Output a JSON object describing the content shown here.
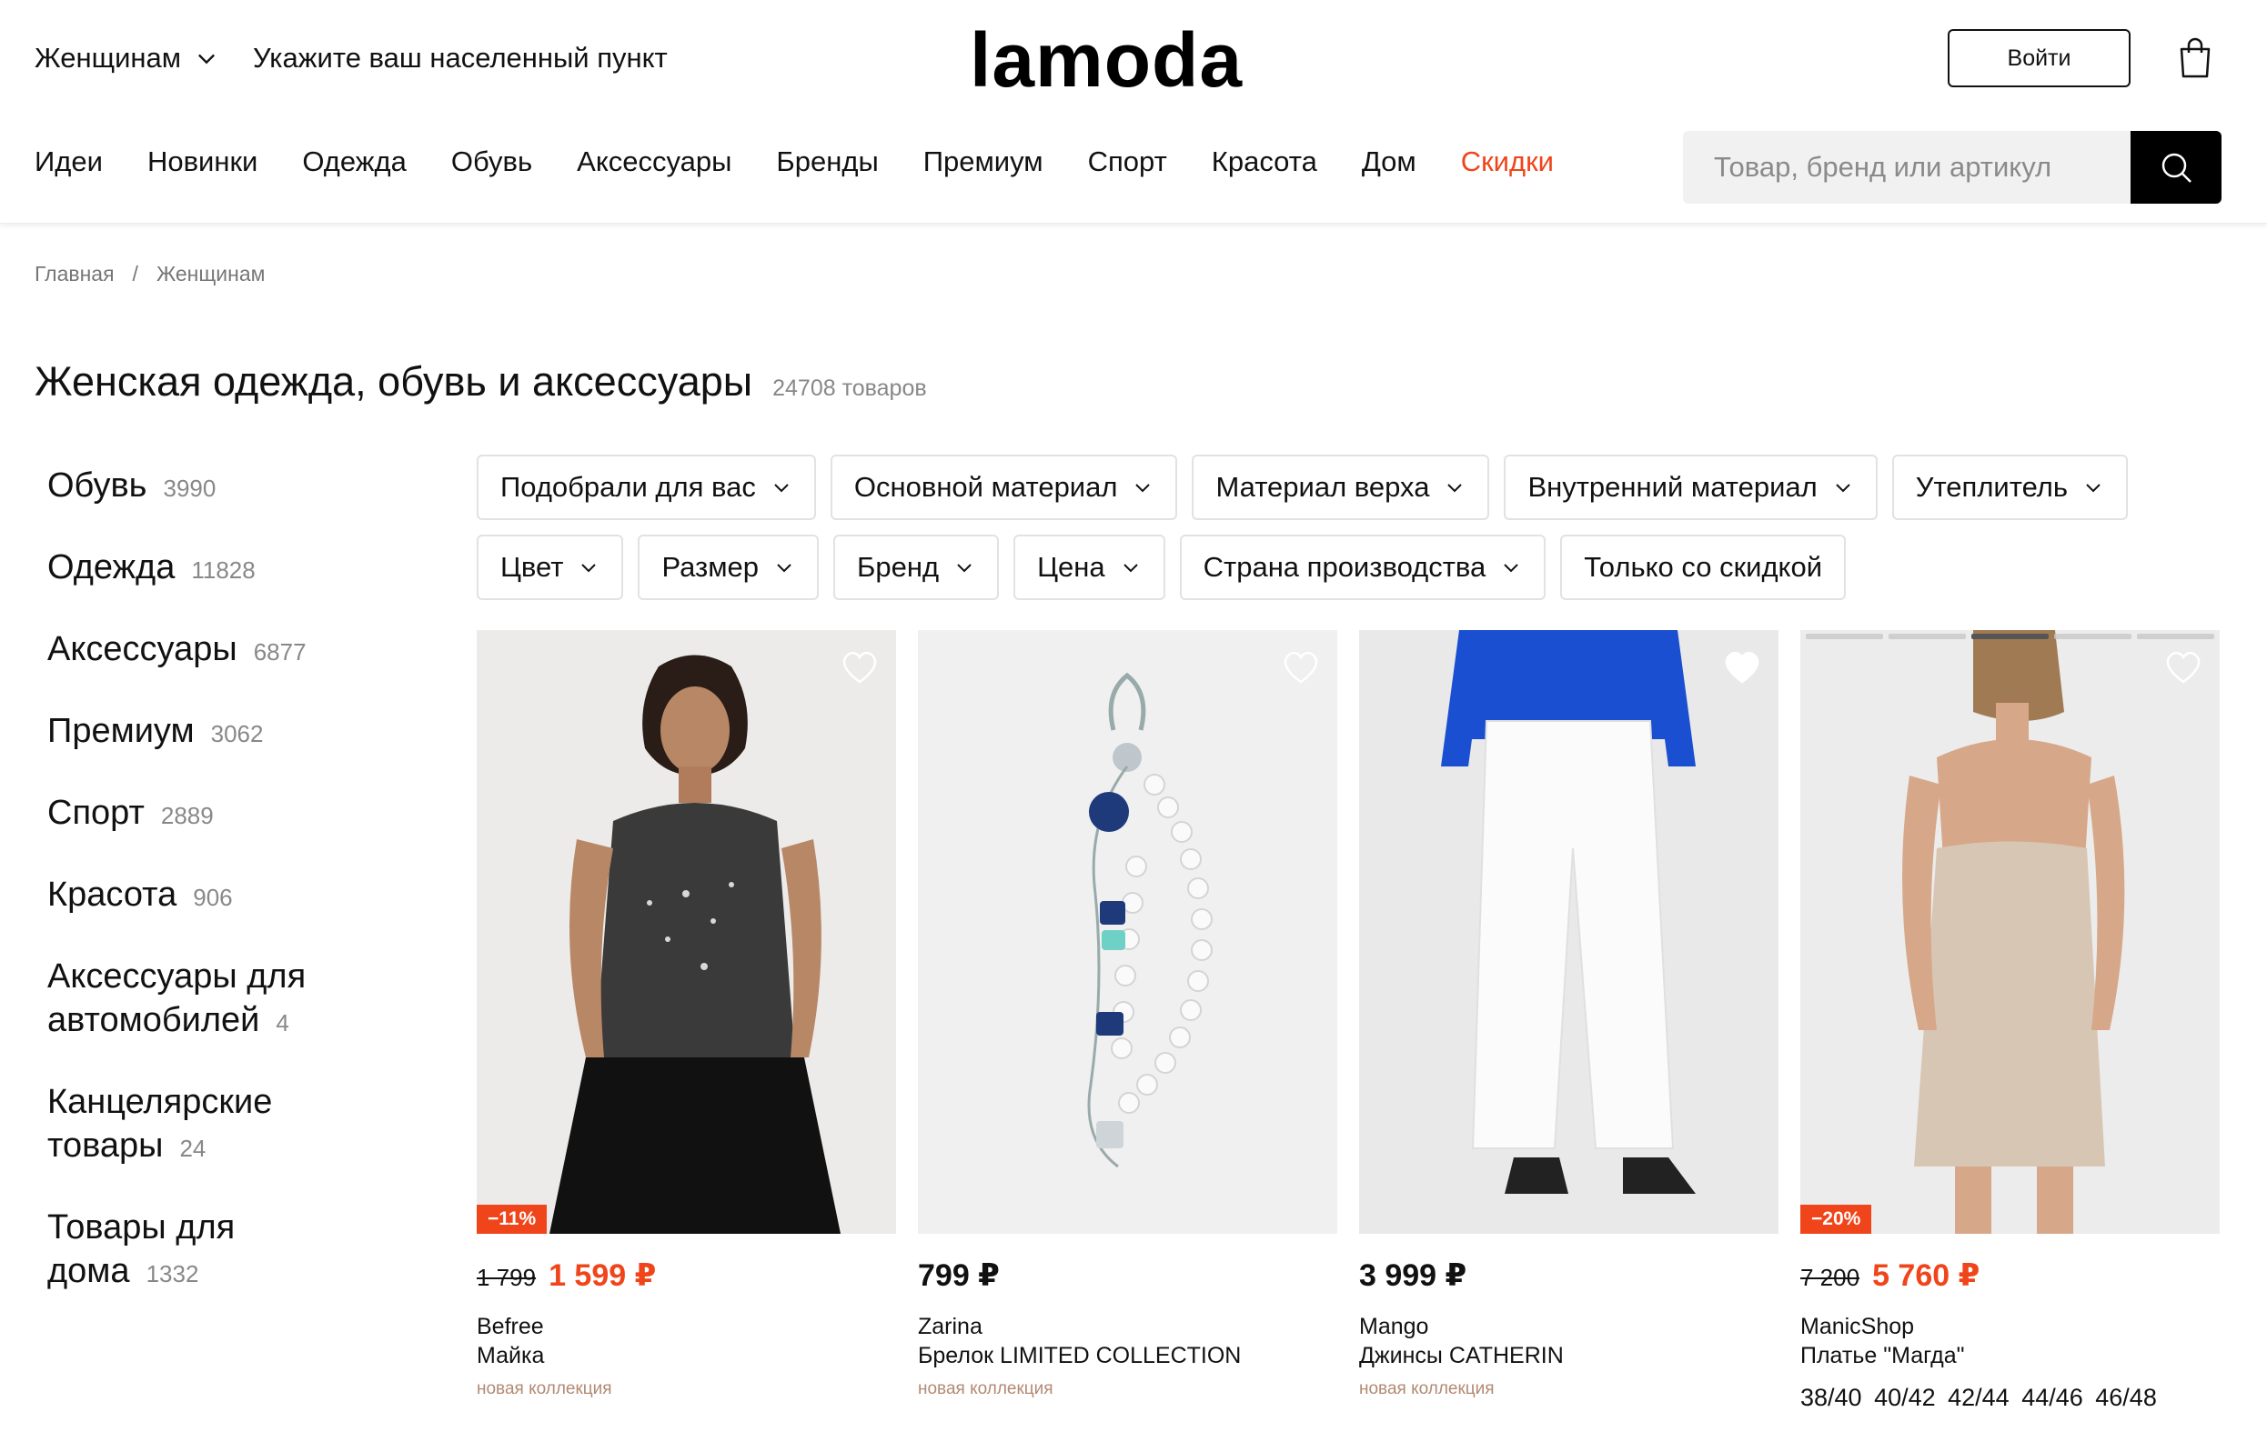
{
  "header": {
    "gender": "Женщинам",
    "location": "Укажите ваш населенный пункт",
    "logo": "lamoda",
    "login": "Войти",
    "search_placeholder": "Товар, бренд или артикул"
  },
  "nav": [
    "Идеи",
    "Новинки",
    "Одежда",
    "Обувь",
    "Аксессуары",
    "Бренды",
    "Премиум",
    "Спорт",
    "Красота",
    "Дом",
    "Скидки"
  ],
  "accent_color": "#f0451a",
  "breadcrumb": {
    "home": "Главная",
    "sep": "/",
    "current": "Женщинам"
  },
  "page": {
    "title": "Женская одежда, обувь и аксессуары",
    "count": "24708 товаров"
  },
  "categories": [
    {
      "name": "Обувь",
      "count": "3990"
    },
    {
      "name": "Одежда",
      "count": "11828"
    },
    {
      "name": "Аксессуары",
      "count": "6877"
    },
    {
      "name": "Премиум",
      "count": "3062"
    },
    {
      "name": "Спорт",
      "count": "2889"
    },
    {
      "name": "Красота",
      "count": "906"
    },
    {
      "name": "Аксессуары для автомобилей",
      "count": "4"
    },
    {
      "name": "Канцелярские товары",
      "count": "24"
    },
    {
      "name": "Товары для дома",
      "count": "1332"
    }
  ],
  "filters_row1": [
    "Подобрали для вас",
    "Основной материал",
    "Материал верха",
    "Внутренний материал",
    "Утеплитель"
  ],
  "filters_row2": [
    "Цвет",
    "Размер",
    "Бренд",
    "Цена",
    "Страна производства"
  ],
  "filter_discount": "Только со скидкой",
  "products": [
    {
      "old_price": "1 799",
      "price": "1 599 ₽",
      "discount": "−11%",
      "brand": "Befree",
      "name": "Майка",
      "tag": "новая коллекция"
    },
    {
      "old_price": "",
      "price": "799 ₽",
      "discount": "",
      "brand": "Zarina",
      "name": "Брелок LIMITED COLLECTION",
      "tag": "новая коллекция"
    },
    {
      "old_price": "",
      "price": "3 999 ₽",
      "discount": "",
      "brand": "Mango",
      "name": "Джинсы CATHERIN",
      "tag": "новая коллекция"
    },
    {
      "old_price": "7 200",
      "price": "5 760 ₽",
      "discount": "−20%",
      "brand": "ManicShop",
      "name": "Платье \"Магда\"",
      "sizes": "38/40 40/42 42/44 44/46 46/48"
    }
  ]
}
